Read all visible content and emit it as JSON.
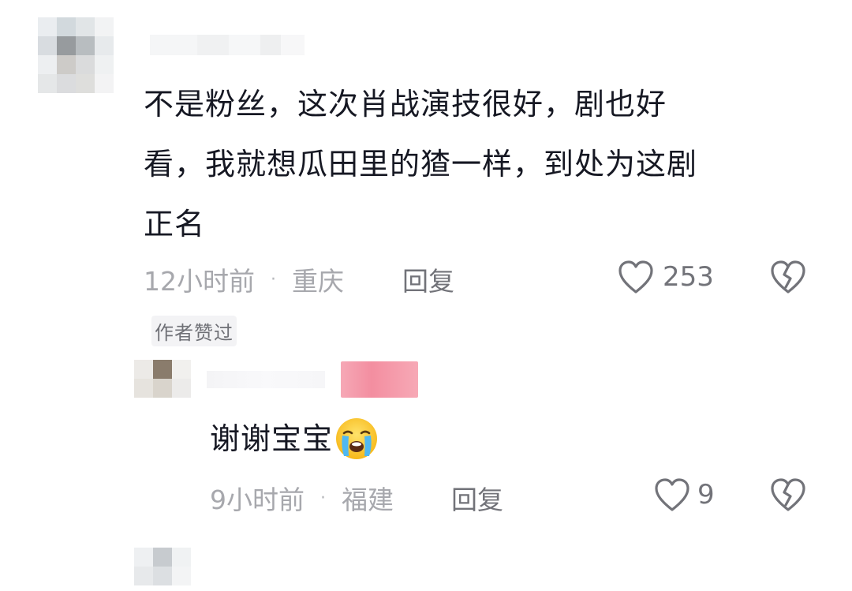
{
  "comment": {
    "lines": [
      "不是粉丝，这次肖战演技很好，剧也好",
      "看，我就想瓜田里的猹一样，到处为这剧",
      "正名"
    ],
    "time": "12小时前",
    "location": "重庆",
    "reply_label": "回复",
    "like_count": "253",
    "author_liked_badge": "作者赞过"
  },
  "reply": {
    "text": "谢谢宝宝",
    "emoji": "loudly-crying-face",
    "time": "9小时前",
    "location": "福建",
    "reply_label": "回复",
    "like_count": "9"
  },
  "colors": {
    "text": "#161823",
    "meta": "#a7a8ad",
    "action": "#727379",
    "username_highlight": "#f38ea0"
  }
}
